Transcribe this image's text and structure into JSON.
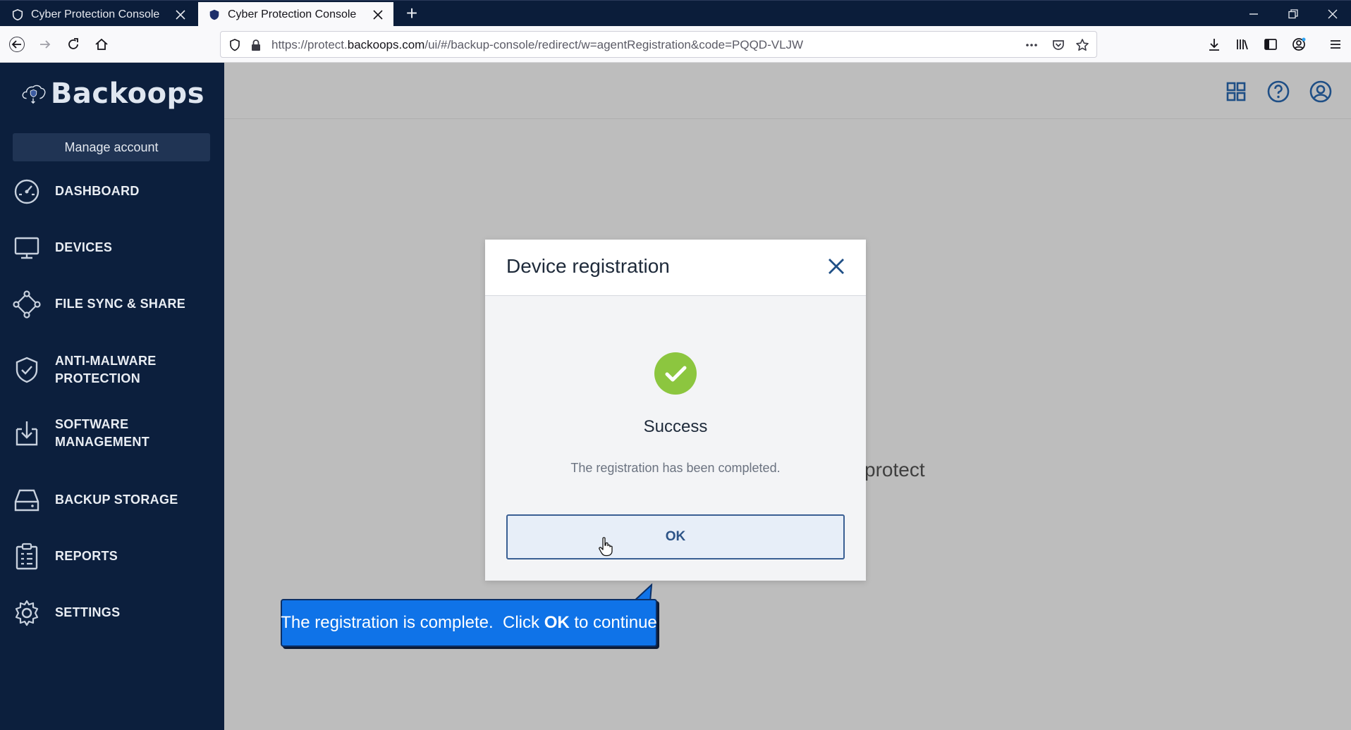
{
  "browser": {
    "tabs": [
      {
        "title": "Cyber Protection Console",
        "active": false
      },
      {
        "title": "Cyber Protection Console",
        "active": true
      }
    ],
    "url_prefix": "https://protect.",
    "url_host": "backoops.com",
    "url_path": "/ui/#/backup-console/redirect/w=agentRegistration&code=PQQD-VLJW"
  },
  "app": {
    "logo_text": "Backoops",
    "manage_account_label": "Manage account",
    "nav": [
      {
        "label": "DASHBOARD",
        "icon": "dashboard-icon"
      },
      {
        "label": "DEVICES",
        "icon": "devices-icon"
      },
      {
        "label": "FILE SYNC & SHARE",
        "icon": "file-sync-share-icon"
      },
      {
        "label_line1": "ANTI-MALWARE",
        "label_line2": "PROTECTION",
        "icon": "anti-malware-shield-icon"
      },
      {
        "label_line1": "SOFTWARE",
        "label_line2": "MANAGEMENT",
        "icon": "software-management-icon"
      },
      {
        "label": "BACKUP STORAGE",
        "icon": "backup-storage-icon"
      },
      {
        "label": "REPORTS",
        "icon": "reports-icon"
      },
      {
        "label": "SETTINGS",
        "icon": "settings-gear-icon"
      }
    ],
    "background_text": "protect"
  },
  "modal": {
    "title": "Device registration",
    "status_title": "Success",
    "status_message": "The registration has been completed.",
    "ok_label": "OK"
  },
  "callout": {
    "text_before": "The registration is complete.  Click ",
    "text_bold": "OK",
    "text_after": " to continue"
  },
  "colors": {
    "sidebar_bg": "#0c1f3d",
    "success_green": "#8cc63f",
    "ok_border": "#3a5f93",
    "callout_bg": "#0f73e8"
  }
}
